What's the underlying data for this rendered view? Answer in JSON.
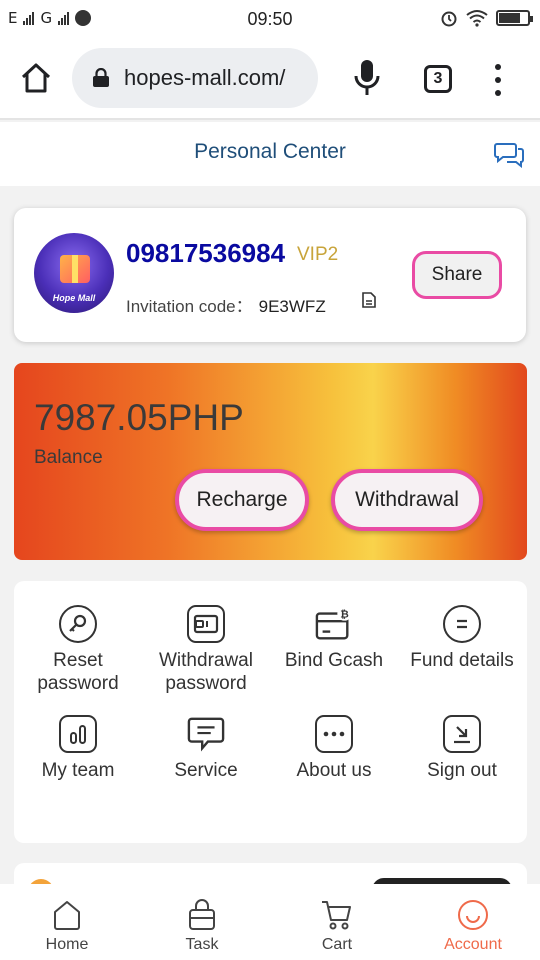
{
  "status_bar": {
    "time": "09:50",
    "sim1": "E",
    "sim2": "G",
    "battery_level": 0.75
  },
  "browser": {
    "url": "hopes-mall.com/",
    "tab_count": "3"
  },
  "header": {
    "title": "Personal Center"
  },
  "user": {
    "phone": "09817536984",
    "vip": "VIP2",
    "invite_label": "Invitation code：",
    "invite_code": "9E3WFZ",
    "avatar_brand": "Hope Mall",
    "share_label": "Share"
  },
  "balance": {
    "amount": "7987.05PHP",
    "label": "Balance",
    "recharge_label": "Recharge",
    "withdraw_label": "Withdrawal"
  },
  "menu": [
    {
      "label": "Reset password",
      "icon": "key-icon"
    },
    {
      "label": "Withdrawal password",
      "icon": "wallet-icon"
    },
    {
      "label": "Bind Gcash",
      "icon": "card-bitcoin-icon"
    },
    {
      "label": "Fund details",
      "icon": "list-icon"
    },
    {
      "label": "My team",
      "icon": "bar-chart-icon"
    },
    {
      "label": "Service",
      "icon": "chat-bubble-icon"
    },
    {
      "label": "About us",
      "icon": "more-dots-icon"
    },
    {
      "label": "Sign out",
      "icon": "sign-out-icon"
    }
  ],
  "nav": [
    {
      "label": "Home",
      "icon": "home-icon"
    },
    {
      "label": "Task",
      "icon": "bag-icon"
    },
    {
      "label": "Cart",
      "icon": "cart-icon"
    },
    {
      "label": "Account",
      "icon": "smile-icon"
    }
  ],
  "colors": {
    "accent": "#ef6a4a",
    "button_border": "#e94ba4",
    "phone_text": "#0a0aa0",
    "vip_text": "#c8a43a",
    "header_text": "#1f4e79"
  }
}
